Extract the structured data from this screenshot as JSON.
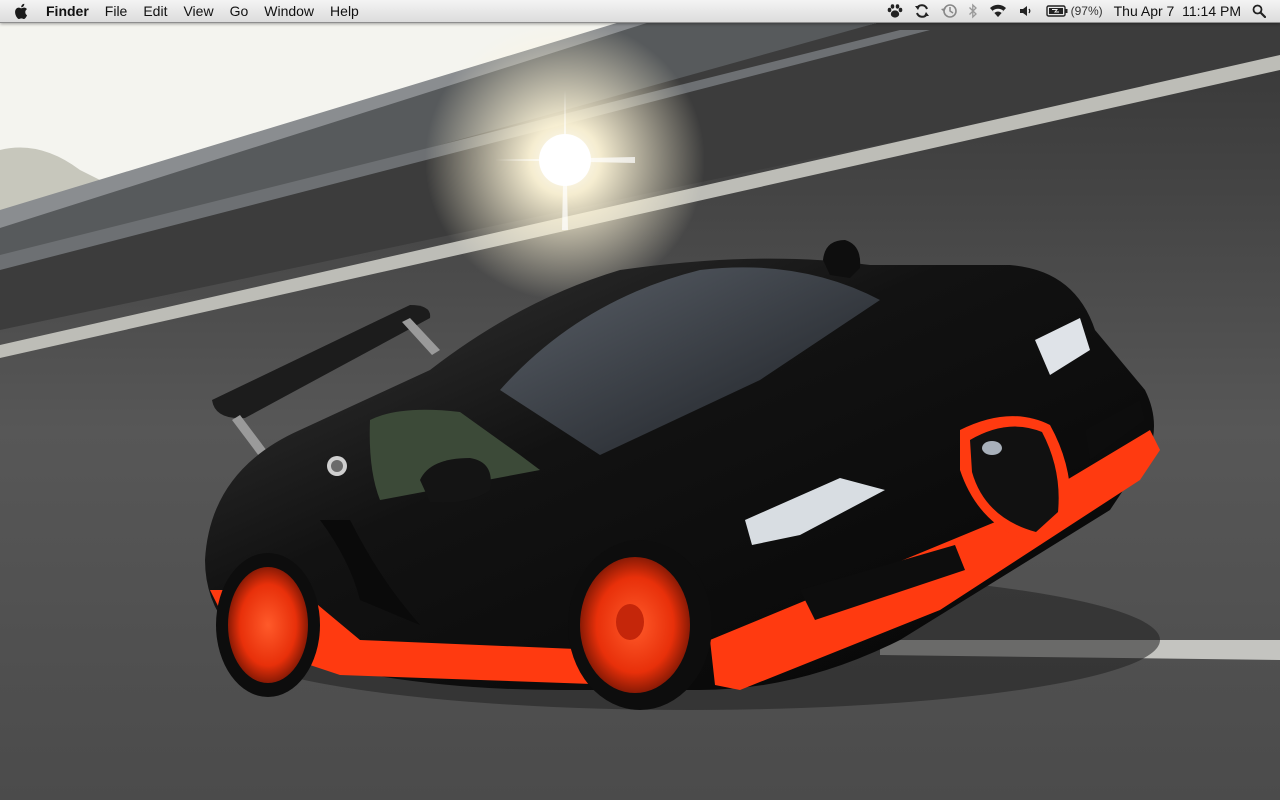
{
  "menubar": {
    "app_name": "Finder",
    "items": [
      "File",
      "Edit",
      "View",
      "Go",
      "Window",
      "Help"
    ],
    "status": {
      "icons": [
        "paw-icon",
        "sync-icon",
        "time-machine-icon",
        "bluetooth-icon",
        "wifi-icon",
        "volume-icon",
        "battery-icon",
        "spotlight-icon"
      ],
      "battery_percent": "(97%)",
      "clock": "Thu Apr 7  11:14 PM"
    }
  },
  "desktop": {
    "wallpaper": "black-and-orange-sports-car-on-track",
    "colors": {
      "car_body": "#141414",
      "car_accent": "#ff3a10",
      "road": "#4a4a4a",
      "sky": "#f6f6f2"
    }
  }
}
